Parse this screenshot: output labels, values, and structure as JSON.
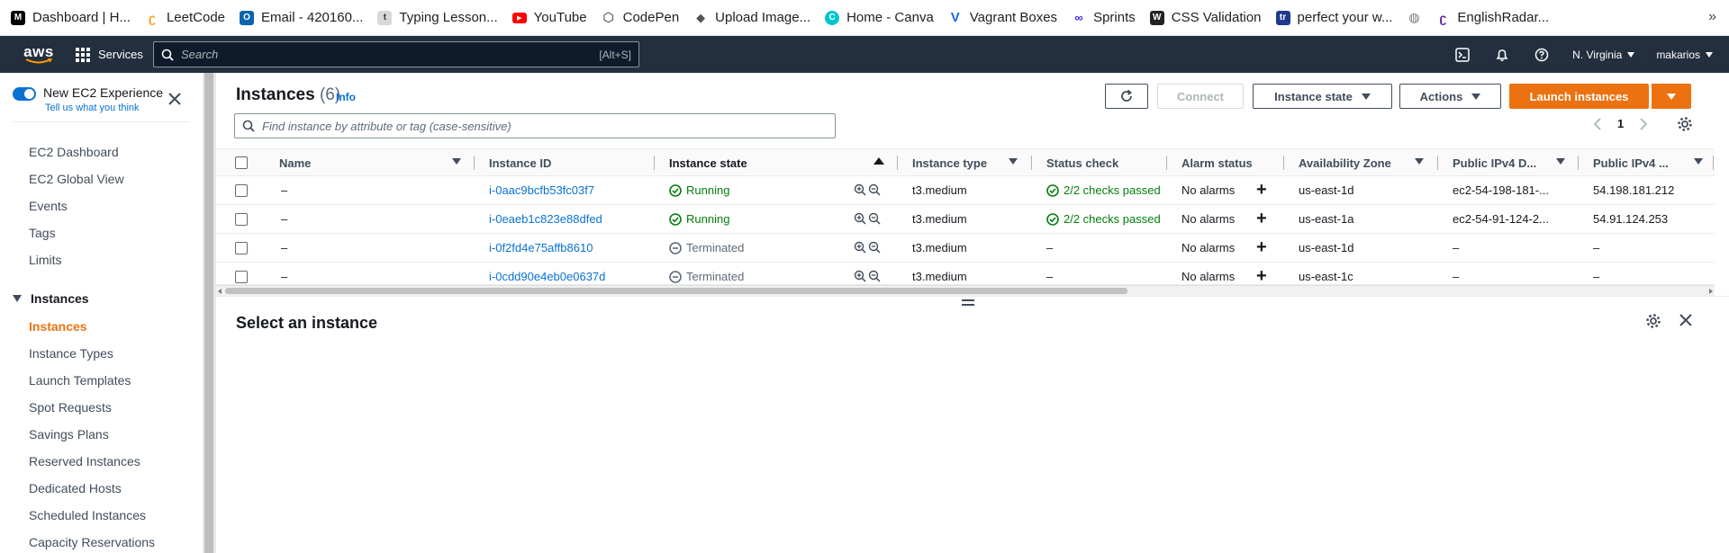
{
  "bookmarks": [
    {
      "label": "Dashboard | H...",
      "icon": "dev-icon",
      "color": "#000000"
    },
    {
      "label": "LeetCode",
      "icon": "leetcode-icon",
      "color": "#f89f1b"
    },
    {
      "label": "Email - 420160...",
      "icon": "outlook-icon",
      "color": "#0a64ad"
    },
    {
      "label": "Typing Lesson...",
      "icon": "typing-icon",
      "color": "#8a8a8a"
    },
    {
      "label": "YouTube",
      "icon": "youtube-icon",
      "color": "#ff0000"
    },
    {
      "label": "CodePen",
      "icon": "codepen-icon",
      "color": "#111111"
    },
    {
      "label": "Upload Image...",
      "icon": "upload-icon",
      "color": "#555555"
    },
    {
      "label": "Home - Canva",
      "icon": "canva-icon",
      "color": "#00c4cc"
    },
    {
      "label": "Vagrant Boxes",
      "icon": "vagrant-icon",
      "color": "#1868f2"
    },
    {
      "label": "Sprints",
      "icon": "sprints-icon",
      "color": "#3d2bd8"
    },
    {
      "label": "CSS Validation",
      "icon": "w3c-icon",
      "color": "#222222"
    },
    {
      "label": "perfect your w...",
      "icon": "tr-icon",
      "color": "#1e3a8a"
    },
    {
      "label": "",
      "icon": "globe-icon",
      "color": "#777777"
    },
    {
      "label": "EnglishRadar...",
      "icon": "englishradar-icon",
      "color": "#5b1fa8"
    }
  ],
  "bookmarks_more": "»",
  "topnav": {
    "logo": "aws",
    "services_label": "Services",
    "search_placeholder": "Search",
    "search_hint": "[Alt+S]",
    "region": "N. Virginia",
    "user": "makarios"
  },
  "sidebar": {
    "toggle_label": "New EC2 Experience",
    "toggle_sub": "Tell us what you think",
    "items_top": [
      "EC2 Dashboard",
      "EC2 Global View",
      "Events",
      "Tags",
      "Limits"
    ],
    "section": "Instances",
    "items_instances": [
      "Instances",
      "Instance Types",
      "Launch Templates",
      "Spot Requests",
      "Savings Plans",
      "Reserved Instances",
      "Dedicated Hosts",
      "Scheduled Instances",
      "Capacity Reservations"
    ],
    "active": "Instances"
  },
  "header": {
    "title": "Instances",
    "count": "(6)",
    "info": "Info",
    "connect": "Connect",
    "instance_state": "Instance state",
    "actions": "Actions",
    "launch": "Launch instances",
    "filter_placeholder": "Find instance by attribute or tag (case-sensitive)",
    "page": "1"
  },
  "table": {
    "columns": [
      "Name",
      "Instance ID",
      "Instance state",
      "Instance type",
      "Status check",
      "Alarm status",
      "Availability Zone",
      "Public IPv4 D...",
      "Public IPv4 ..."
    ],
    "rows": [
      {
        "name": "–",
        "id": "i-0aac9bcfb53fc03f7",
        "state": "Running",
        "type": "t3.medium",
        "check": "2/2 checks passed",
        "alarm": "No alarms",
        "az": "us-east-1d",
        "dns": "ec2-54-198-181-...",
        "ip": "54.198.181.212"
      },
      {
        "name": "–",
        "id": "i-0eaeb1c823e88dfed",
        "state": "Running",
        "type": "t3.medium",
        "check": "2/2 checks passed",
        "alarm": "No alarms",
        "az": "us-east-1a",
        "dns": "ec2-54-91-124-2...",
        "ip": "54.91.124.253"
      },
      {
        "name": "–",
        "id": "i-0f2fd4e75affb8610",
        "state": "Terminated",
        "type": "t3.medium",
        "check": "–",
        "alarm": "No alarms",
        "az": "us-east-1d",
        "dns": "–",
        "ip": "–"
      },
      {
        "name": "–",
        "id": "i-0cdd90e4eb0e0637d",
        "state": "Terminated",
        "type": "t3.medium",
        "check": "–",
        "alarm": "No alarms",
        "az": "us-east-1c",
        "dns": "–",
        "ip": "–"
      }
    ]
  },
  "detail": {
    "title": "Select an instance"
  },
  "colors": {
    "nav_bg": "#232f3e",
    "accent_orange": "#ec7211",
    "link_blue": "#0972d3",
    "success_green": "#037f0c"
  }
}
